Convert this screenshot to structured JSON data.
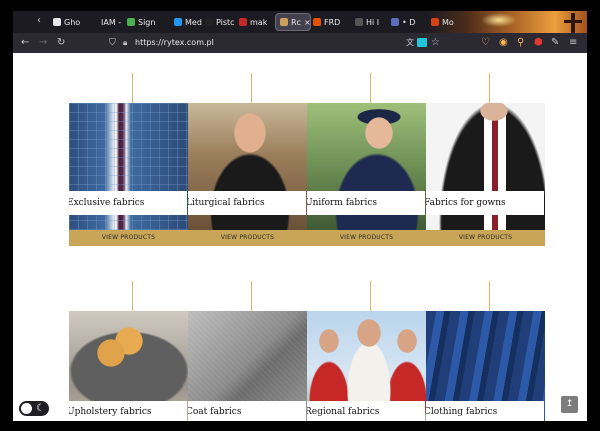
{
  "browser": {
    "tabs": [
      {
        "label": "",
        "color": "#1c1b22"
      },
      {
        "label": "Gho",
        "color": "#e8e8ea"
      },
      {
        "label": "IAM - O",
        "color": "#1c1b22"
      },
      {
        "label": "Sign",
        "color": "#4caf50"
      },
      {
        "label": "Med",
        "color": "#2196f3"
      },
      {
        "label": "Pistc",
        "color": "#222222"
      },
      {
        "label": "mak",
        "color": "#c62828"
      },
      {
        "label": "Rc",
        "color": "#caa05a",
        "active": true
      },
      {
        "label": "FRD",
        "color": "#e65100"
      },
      {
        "label": "Hi I",
        "color": "#555555"
      },
      {
        "label": "• D",
        "color": "#5c6bc0"
      },
      {
        "label": "Mo",
        "color": "#d84315"
      }
    ],
    "active_tab_close": "×",
    "url": "https://rytex.com.pl"
  },
  "categories_row1": [
    {
      "label": "Exclusive fabrics",
      "button": "VIEW PRODUCTS"
    },
    {
      "label": "Liturgical fabrics",
      "button": "VIEW PRODUCTS"
    },
    {
      "label": "Uniform fabrics",
      "button": "VIEW PRODUCTS"
    },
    {
      "label": "Fabrics for gowns",
      "button": "VIEW PRODUCTS"
    }
  ],
  "categories_row2": [
    {
      "label": "Upholstery fabrics"
    },
    {
      "label": "Coat fabrics"
    },
    {
      "label": "Regional fabrics"
    },
    {
      "label": "Clothing fabrics"
    }
  ],
  "theme_toggle": {
    "icon": "moon-icon"
  },
  "scroll_top": {
    "icon": "arrow-up-icon",
    "glyph": "↥"
  },
  "colors": {
    "accent": "#c9a657",
    "line": "#d8b66a"
  }
}
